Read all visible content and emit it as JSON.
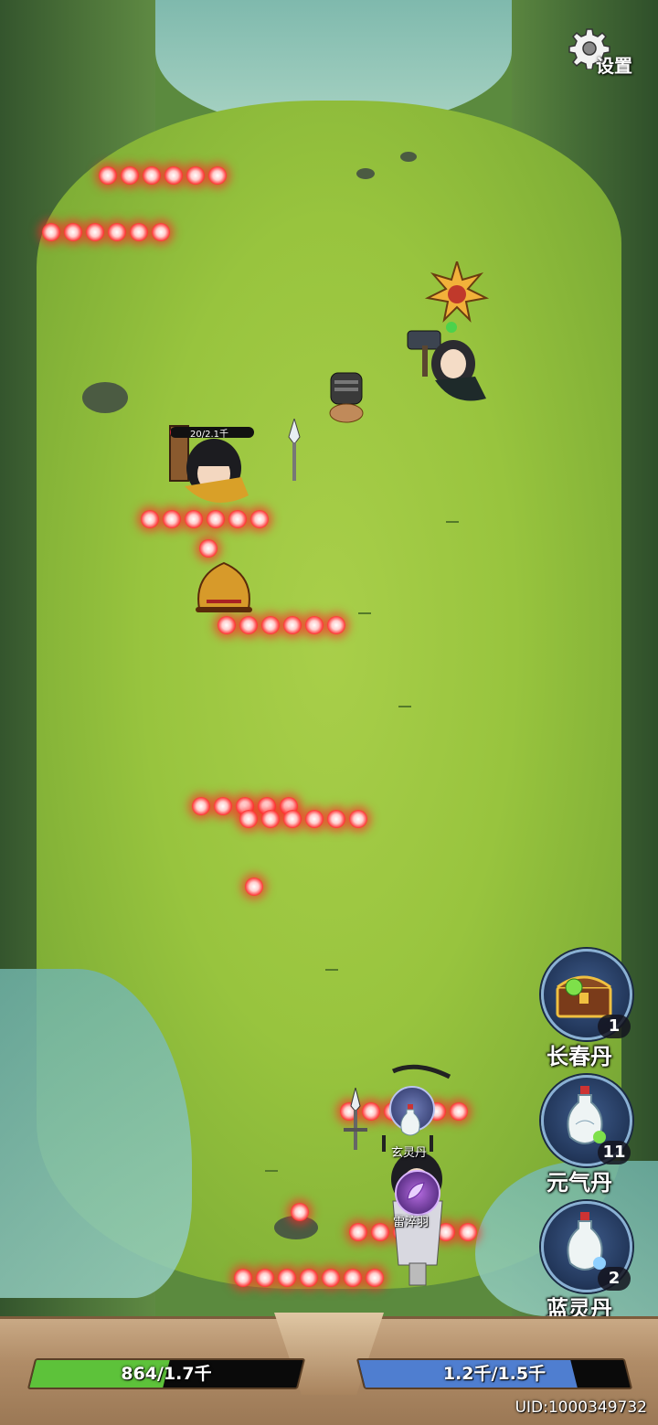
{
  "settings": {
    "label": "设置"
  },
  "enemy": {
    "hp_text": "20/2.1千",
    "hp_fraction": 0.01
  },
  "skills": [
    {
      "label": "玄灵丹"
    },
    {
      "label": "雷淬羽"
    }
  ],
  "pills": [
    {
      "name": "长春丹",
      "count": "1",
      "icon": "treasure-chest-icon"
    },
    {
      "name": "元气丹",
      "count": "11",
      "icon": "white-vase-icon"
    },
    {
      "name": "蓝灵丹",
      "count": "2",
      "icon": "white-vase-icon"
    }
  ],
  "hud": {
    "hp": {
      "text": "864/1.7千",
      "fraction": 0.5,
      "color": "#5dc23a"
    },
    "mp": {
      "text": "1.2千/1.5千",
      "fraction": 0.8,
      "color": "#4f7ed0"
    },
    "uid": "UID:1000349732"
  },
  "colors": {
    "bullet": "#ff3030",
    "hud_frame": "#b08c67"
  }
}
